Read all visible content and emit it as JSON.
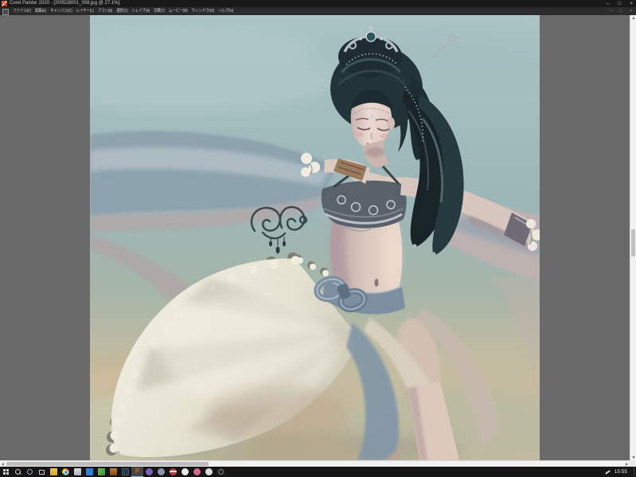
{
  "window": {
    "app_title": "Corel Painter 2020 - [200528001_008.jpg @ 27.1%]",
    "controls": {
      "minimize": "–",
      "maximize": "□",
      "close": "×"
    },
    "child_controls": {
      "minimize": "–",
      "restore": "□",
      "close": "×"
    }
  },
  "menu_bar": {
    "items": [
      "ファイル(F)",
      "編集(E)",
      "キャンバス(C)",
      "レイヤー(L)",
      "ブラシ(B)",
      "選択(S)",
      "シェイプ(A)",
      "効果(T)",
      "ムービー(M)",
      "ウィンドウ(W)",
      "ヘルプ(H)"
    ]
  },
  "document": {
    "filename": "200528001_008.jpg",
    "zoom_level": "27.1%",
    "palette": {
      "pasteboard_gray": "#696969",
      "background_teal": "#9db8ba",
      "background_sand": "#c9bda4",
      "hair_dark_teal": "#22343a",
      "skin": "#dccabf",
      "skirt_cream": "#ece8dc",
      "sash_blue_gray": "#7d90a2",
      "metal_silver": "#b9c3c9",
      "veil_blue": "#8da2ae"
    }
  },
  "taskbar": {
    "clock": "15:55",
    "painter_initial": "P",
    "system_buttons": [
      "start",
      "search",
      "cortana",
      "task-view"
    ],
    "pinned_apps": [
      "file-explorer",
      "chrome",
      "app-light",
      "app-blue",
      "app-green",
      "app-orange",
      "app-dark-blue",
      "corel-painter-active"
    ],
    "profile_icons": [
      "purple",
      "gray-blue",
      "red-white-band",
      "white",
      "pink",
      "light-gray",
      "dark-ring"
    ],
    "tray": [
      "pen",
      "clock",
      "show-desktop"
    ]
  }
}
